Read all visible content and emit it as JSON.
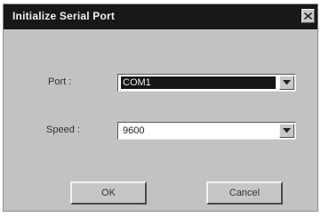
{
  "dialog": {
    "title": "Initialize Serial Port"
  },
  "form": {
    "port_label": "Port :",
    "port_value": "COM1",
    "speed_label": "Speed :",
    "speed_value": "9600"
  },
  "buttons": {
    "ok_label": "OK",
    "cancel_label": "Cancel"
  },
  "icons": {
    "close": "close-icon",
    "dropdown": "chevron-down-icon"
  }
}
